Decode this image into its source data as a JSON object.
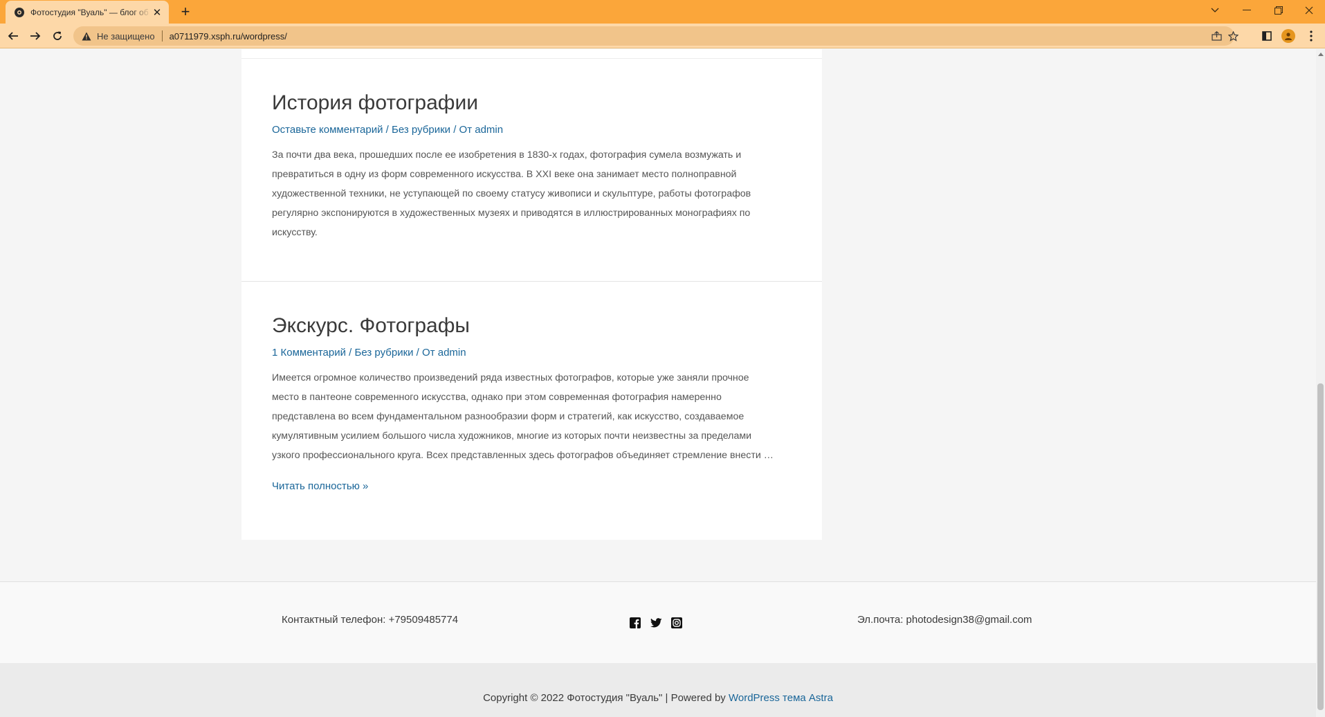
{
  "browser": {
    "tab_title": "Фотостудия \"Вуаль\" — блог об фотографии",
    "address_security": "Не защищено",
    "address_url": "a0711979.xsph.ru/wordpress/"
  },
  "posts": [
    {
      "title": "История фотографии",
      "meta": {
        "comments": "Оставьте комментарий",
        "sep1": " / ",
        "category": "Без рубрики",
        "sep2": " / ",
        "author": "От admin"
      },
      "excerpt_lines": [
        "За почти два века, прошедших после ее изобретения в 1830-х годах, фотография сумела возмужать и",
        "превратиться в одну из форм современного искусства. В XXI веке она занимает место полноправной",
        "художественной техники, не уступающей по своему статусу живописи и скульптуре, работы фотографов",
        "регулярно экспонируются в художественных музеях и приводятся в иллюстрированных монографиях по",
        "искусству."
      ]
    },
    {
      "title": "Экскурс. Фотографы",
      "meta": {
        "comments": "1 Комментарий",
        "sep1": " / ",
        "category": "Без рубрики",
        "sep2": " / ",
        "author": "От admin"
      },
      "excerpt_lines": [
        "Имеется огромное количество произведений ряда известных фотографов, которые уже заняли прочное",
        "место в пантеоне современного искусства, однако при этом современная фотография намеренно",
        "представлена во всем фундаментальном разнообразии форм и стратегий, как искусство, создаваемое",
        "кумулятивным усилием большого числа художников, многие из которых почти неизвестны за пределами",
        "узкого профессионального круга. Всех представленных здесь фотографов объединяет стремление внести …"
      ],
      "read_more": "Читать полностью »"
    }
  ],
  "footer": {
    "phone": "Контактный телефон: +79509485774",
    "email": "Эл.почта: photodesign38@gmail.com",
    "socials": [
      "facebook-icon",
      "twitter-icon",
      "instagram-icon"
    ],
    "copyright_prefix": "Copyright © 2022 Фотостудия \"Вуаль\" | Powered by ",
    "copyright_link": "WordPress тема Astra"
  },
  "colors": {
    "tab_bar": "#fba63a",
    "toolbar": "#fdd8a8",
    "link": "#1a6699",
    "text": "#3a3a3a"
  }
}
